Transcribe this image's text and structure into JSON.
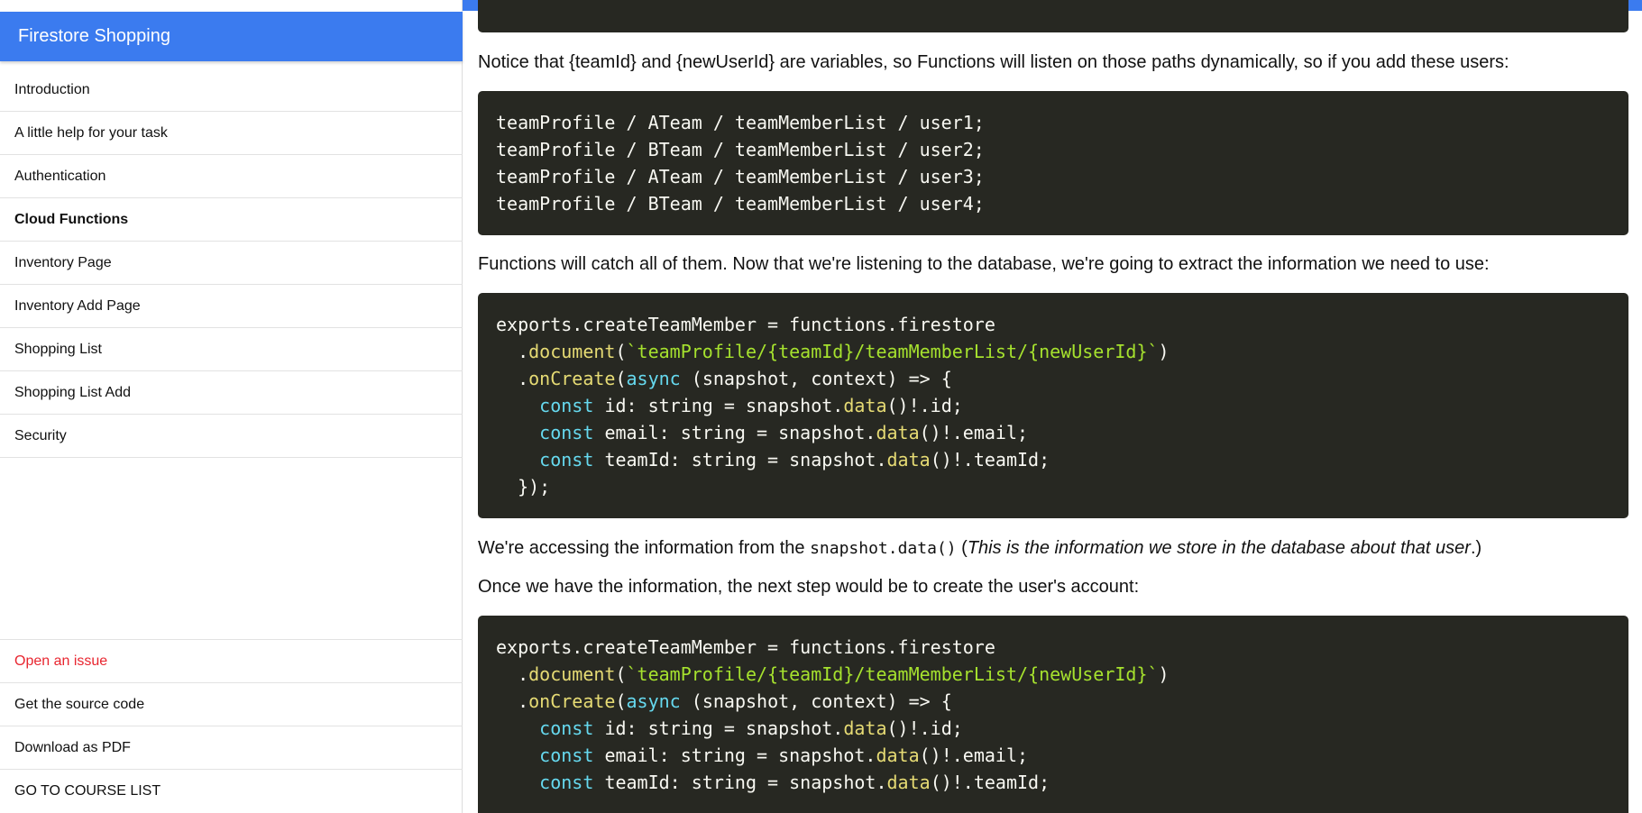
{
  "sidebar": {
    "title": "Firestore Shopping",
    "items": [
      {
        "label": "Introduction"
      },
      {
        "label": "A little help for your task"
      },
      {
        "label": "Authentication"
      },
      {
        "label": "Cloud Functions"
      },
      {
        "label": "Inventory Page"
      },
      {
        "label": "Inventory Add Page"
      },
      {
        "label": "Shopping List"
      },
      {
        "label": "Shopping List Add"
      },
      {
        "label": "Security"
      }
    ],
    "footer": [
      {
        "label": "Open an issue"
      },
      {
        "label": "Get the source code"
      },
      {
        "label": "Download as PDF"
      },
      {
        "label": "GO TO COURSE LIST"
      }
    ]
  },
  "content": {
    "para1": "Notice that {teamId} and {newUserId} are variables, so Functions will listen on those paths dynamically, so if you add these users:",
    "code1": [
      "teamProfile / ATeam / teamMemberList / user1;",
      "teamProfile / BTeam / teamMemberList / user2;",
      "teamProfile / ATeam / teamMemberList / user3;",
      "teamProfile / BTeam / teamMemberList / user4;"
    ],
    "para2": "Functions will catch all of them. Now that we're listening to the database, we're going to extract the information we need to use:",
    "code": {
      "line1": "exports.createTeamMember = functions.firestore",
      "dot": ".",
      "document": "document",
      "path": "`teamProfile/{teamId}/teamMemberList/{newUserId}`",
      "onCreate": "onCreate",
      "async": "async",
      "args": "(snapshot, context) => {",
      "const": "const",
      "id_decl": "id: string = snapshot.",
      "email_decl": "email: string = snapshot.",
      "team_decl": "teamId: string = snapshot.",
      "data": "data",
      "id_tail": "()!.id;",
      "email_tail": "()!.email;",
      "team_tail": "()!.teamId;",
      "close": "});"
    },
    "para3_pre": "We're accessing the information from the ",
    "para3_code": "snapshot.data()",
    "para3_italic": "This is the information we store in the database about that user",
    "para4": "Once we have the information, the next step would be to create the user's account:"
  }
}
